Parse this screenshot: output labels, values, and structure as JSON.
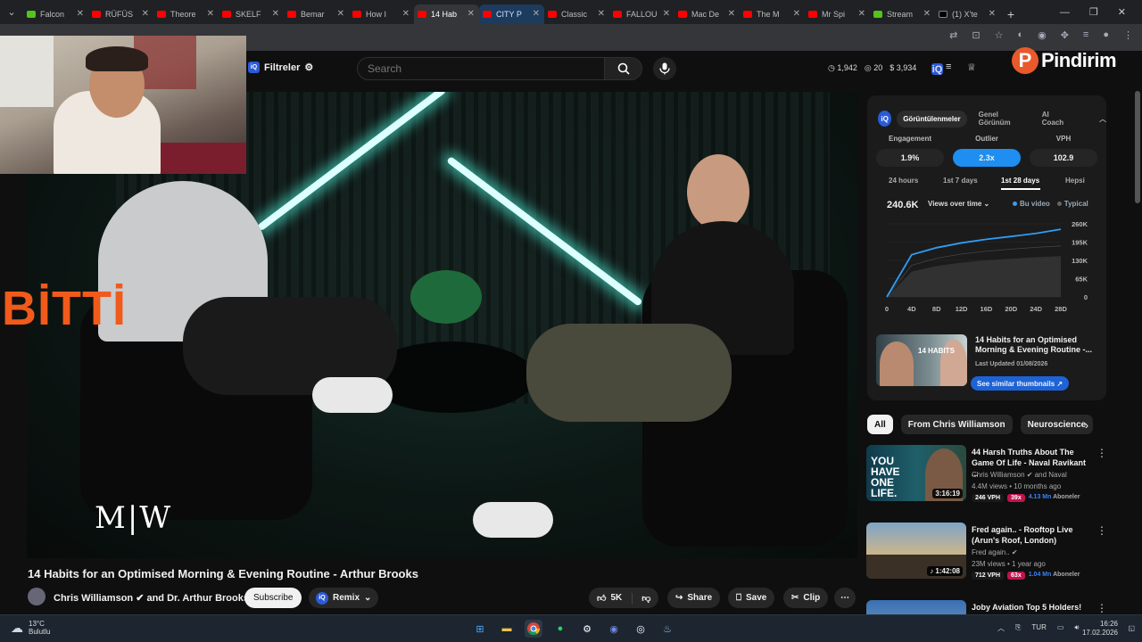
{
  "browser": {
    "tabs": [
      {
        "title": "Falcon",
        "icon": "g"
      },
      {
        "title": "RÜFÜS",
        "icon": "yt"
      },
      {
        "title": "Theore",
        "icon": "yt"
      },
      {
        "title": "SKELF",
        "icon": "yt"
      },
      {
        "title": "Bemar",
        "icon": "yt"
      },
      {
        "title": "How I",
        "icon": "yt"
      },
      {
        "title": "14 Hab",
        "icon": "yt",
        "active": true
      },
      {
        "title": "CITY P",
        "icon": "yt",
        "highlight": true
      },
      {
        "title": "Classic",
        "icon": "yt"
      },
      {
        "title": "FALLOU",
        "icon": "yt"
      },
      {
        "title": "Mac De",
        "icon": "yt"
      },
      {
        "title": "The M",
        "icon": "yt"
      },
      {
        "title": "Mr Spi",
        "icon": "yt"
      },
      {
        "title": "Stream",
        "icon": "g"
      },
      {
        "title": "(1) X'te",
        "icon": "x"
      }
    ],
    "new_tab": "+",
    "window_controls": {
      "minimize": "—",
      "restore": "❐",
      "close": "✕"
    }
  },
  "header": {
    "filters_label": "Filtreler",
    "search_placeholder": "Search",
    "stats": {
      "clock_count": "1,942",
      "views_count": "20",
      "money_count": "3,934"
    }
  },
  "watermark": {
    "brand": "Pindirim",
    "logo_letter": "P"
  },
  "overlay": {
    "bitti": "BİTTİ",
    "video_logo": "M|W"
  },
  "panel": {
    "tabs": [
      "Görüntülenmeler",
      "Genel Görünüm",
      "AI Coach"
    ],
    "metrics": [
      {
        "label": "Engagement",
        "value": "1.9%"
      },
      {
        "label": "Outlier",
        "value": "2.3x",
        "active": true
      },
      {
        "label": "VPH",
        "value": "102.9"
      }
    ],
    "periods": [
      "24 hours",
      "1st 7 days",
      "1st 28 days",
      "Hepsi"
    ],
    "views_total": "240.6K",
    "views_selector": "Views over time",
    "legend": [
      "Bu video",
      "Typical"
    ],
    "card": {
      "title": "14 Habits for an Optimised Morning & Evening Routine -...",
      "updated": "Last Updated 01/08/2026",
      "thumb_text": "14 HABITS",
      "button": "See similar thumbnails"
    }
  },
  "chart_data": {
    "type": "area",
    "x": [
      "0",
      "4D",
      "8D",
      "12D",
      "16D",
      "20D",
      "24D",
      "28D"
    ],
    "y_ticks": [
      "260K",
      "195K",
      "130K",
      "65K",
      "0"
    ],
    "ylim": [
      0,
      260000
    ],
    "series": [
      {
        "name": "Bu video",
        "values": [
          0,
          150000,
          175000,
          192000,
          205000,
          215000,
          226000,
          240600
        ]
      },
      {
        "name": "Typical",
        "values": [
          0,
          90000,
          110000,
          122000,
          130000,
          136000,
          141000,
          145000
        ]
      }
    ]
  },
  "chips": [
    "All",
    "From Chris Williamson",
    "Neuroscience"
  ],
  "recommendations": [
    {
      "title": "44 Harsh Truths About The Game Of Life - Naval Ravikant ...",
      "channel": "Chris Williamson ✔ and Naval",
      "views": "4.4M views • 10 months ago",
      "duration": "3:16:19",
      "vph": "246 VPH",
      "outlier": "39x",
      "subs": "4.13 Mn",
      "subs_label": "Aboneler",
      "thumb_text": "YOU HAVE ONE LIFE."
    },
    {
      "title": "Fred again.. - Rooftop Live (Arun's Roof, London)",
      "channel": "Fred again.. ✔",
      "views": "23M views • 1 year ago",
      "duration": "1:42:08",
      "vph": "712 VPH",
      "outlier": "63x",
      "subs": "1.04 Mn",
      "subs_label": "Aboneler",
      "thumb_text": ""
    },
    {
      "title": "Joby Aviation Top 5 Holders!",
      "channel": "",
      "views": "",
      "duration": "",
      "vph": "",
      "outlier": "",
      "subs": "",
      "subs_label": "",
      "thumb_text": ""
    }
  ],
  "video": {
    "title": "14 Habits for an Optimised Morning & Evening Routine - Arthur Brooks",
    "channel": "Chris Williamson ✔ and Dr. Arthur Brooks",
    "subscribe": "Subscribe",
    "remix": "Remix",
    "likes": "5K",
    "share": "Share",
    "save": "Save",
    "clip": "Clip"
  },
  "taskbar": {
    "temperature": "13°C",
    "weather": "Bulutlu",
    "lang": "TUR",
    "time": "16:26",
    "date": "17.02.2026"
  },
  "colors": {
    "accent": "#1e8ef0",
    "outlier_badge": "#c1134d",
    "bitti": "#f05a1a",
    "brand": "#e85a2b"
  }
}
